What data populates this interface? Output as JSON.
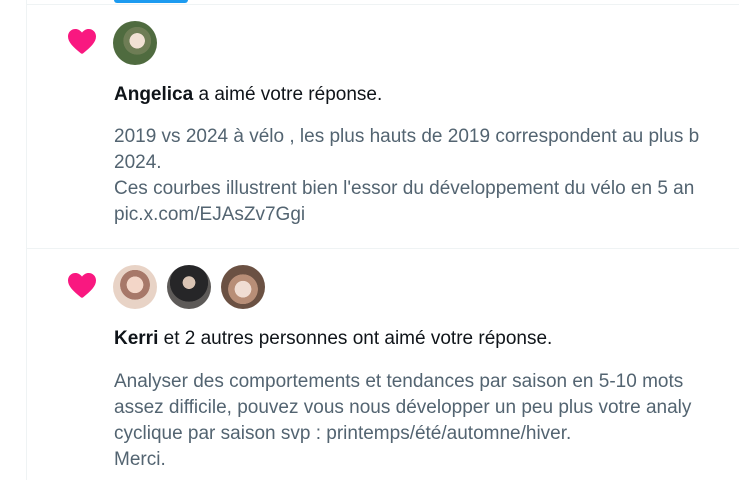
{
  "notifications": [
    {
      "user": "Angelica",
      "action": "a aimé votre réponse.",
      "lines": [
        "2019 vs 2024 à vélo , les plus hauts de 2019 correspondent au plus b",
        "2024.",
        "Ces courbes illustrent bien l'essor du développement du vélo en 5 an",
        "pic.x.com/EJAsZv7Ggi"
      ]
    },
    {
      "user": "Kerri",
      "action": "et 2 autres personnes ont aimé votre réponse.",
      "lines": [
        "Analyser des comportements et tendances par saison en 5-10 mots",
        "assez difficile, pouvez vous nous développer un peu plus votre analy",
        "cyclique par saison svp : printemps/été/automne/hiver.",
        "Merci."
      ]
    }
  ],
  "colors": {
    "heart": "#f91880",
    "muted": "#536471",
    "accent": "#1d9bf0"
  },
  "icons": {
    "like": "heart-icon"
  }
}
